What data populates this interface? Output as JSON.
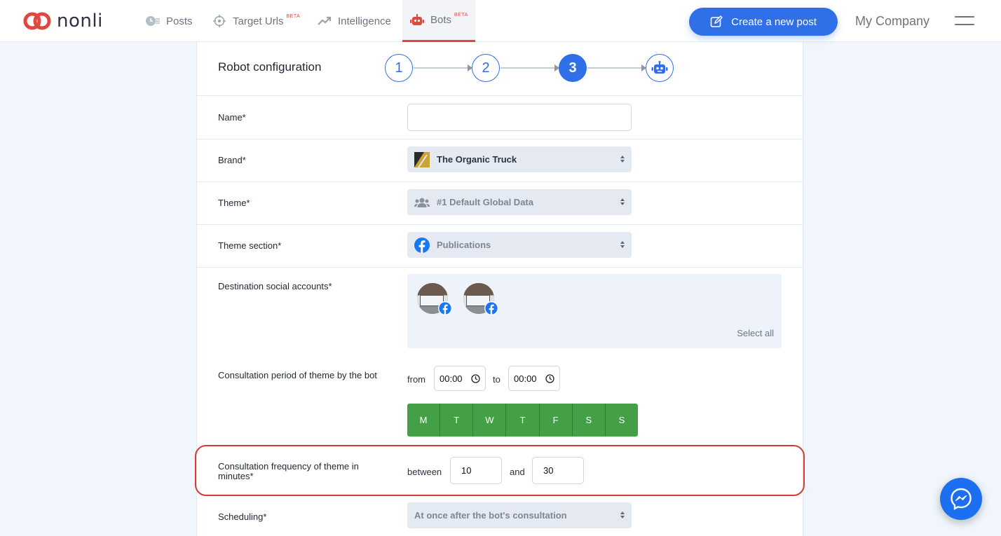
{
  "app": {
    "logo_text": "nonli"
  },
  "nav": {
    "posts": "Posts",
    "target_urls": "Target Urls",
    "target_urls_badge": "BETA",
    "intelligence": "Intelligence",
    "bots": "Bots",
    "bots_badge": "BETA"
  },
  "header": {
    "create_post": "Create a new post",
    "company": "My Company"
  },
  "panel": {
    "title": "Robot configuration",
    "steps": [
      "1",
      "2",
      "3"
    ],
    "active_step": 3
  },
  "form": {
    "name_label": "Name*",
    "name_value": "",
    "brand_label": "Brand*",
    "brand_value": "The Organic Truck",
    "theme_label": "Theme*",
    "theme_value": "#1 Default Global Data",
    "theme_section_label": "Theme section*",
    "theme_section_value": "Publications",
    "destination_label": "Destination social accounts*",
    "select_all": "Select all",
    "consultation_period_label": "Consultation period of theme by the bot",
    "from_label": "from",
    "from_value": "00:00",
    "to_label": "to",
    "to_value": "00:00",
    "days": [
      "M",
      "T",
      "W",
      "T",
      "F",
      "S",
      "S"
    ],
    "frequency_label": "Consultation frequency of theme in minutes*",
    "between_label": "between",
    "between_value": "10",
    "and_label": "and",
    "and_value": "30",
    "scheduling_label": "Scheduling*",
    "scheduling_value": "At once after the bot's consultation"
  },
  "colors": {
    "primary": "#2f6fe8",
    "accent_red": "#e0483f",
    "day_green": "#43a047",
    "highlight": "#d63a35"
  }
}
